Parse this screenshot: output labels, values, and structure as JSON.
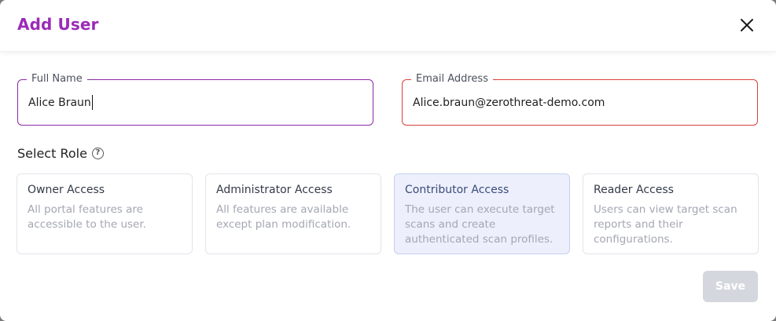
{
  "dialog": {
    "title": "Add User",
    "close_icon": "close-icon"
  },
  "form": {
    "full_name": {
      "label": "Full Name",
      "value": "Alice Braun"
    },
    "email": {
      "label": "Email Address",
      "value": "Alice.braun@zerothreat-demo.com"
    }
  },
  "roles": {
    "section_title": "Select Role",
    "help_icon": "question-circle-icon",
    "help_glyph": "?",
    "items": [
      {
        "title": "Owner Access",
        "description": "All portal features are accessible to the user.",
        "selected": false
      },
      {
        "title": "Administrator Access",
        "description": "All features are available except plan modification.",
        "selected": false
      },
      {
        "title": "Contributor Access",
        "description": "The user can execute target scans and create authenticated scan profiles.",
        "selected": true
      },
      {
        "title": "Reader Access",
        "description": "Users can view target scan reports and their configurations.",
        "selected": false
      }
    ]
  },
  "actions": {
    "save_label": "Save"
  },
  "colors": {
    "title": "#9b2bb8",
    "name_border": "#8a2aa6",
    "email_border": "#d9403a",
    "selected_card_bg": "#edf0fc",
    "save_disabled_bg": "#d5d7de"
  }
}
